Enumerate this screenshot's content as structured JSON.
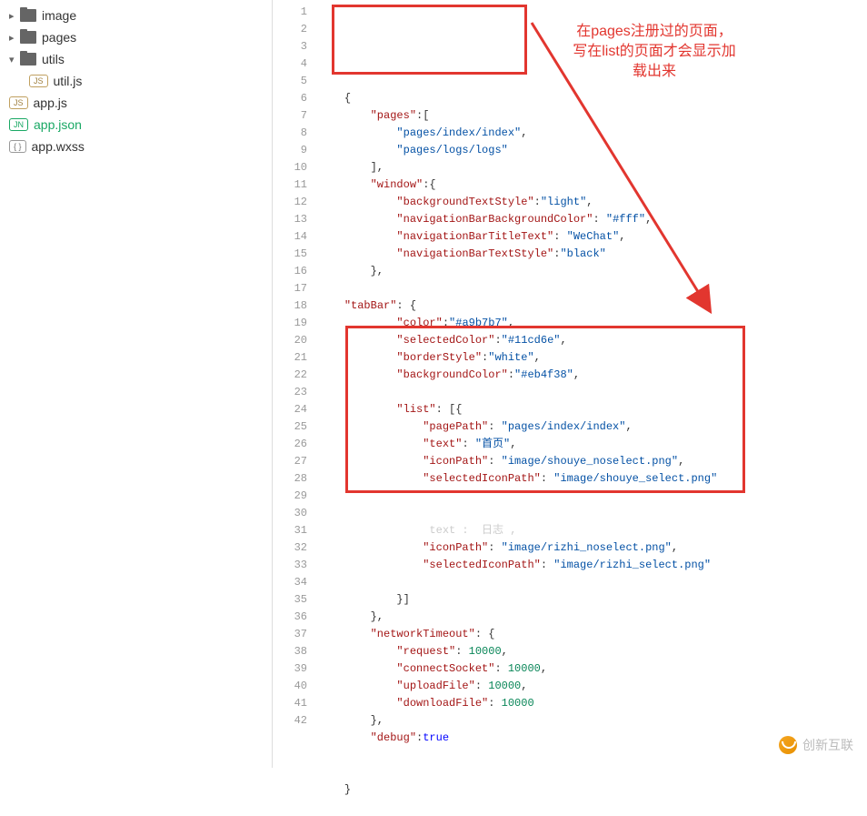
{
  "sidebar": {
    "items": [
      {
        "type": "folder",
        "arrow": "▸",
        "label": "image"
      },
      {
        "type": "folder",
        "arrow": "▸",
        "label": "pages"
      },
      {
        "type": "folder",
        "arrow": "▾",
        "label": "utils"
      },
      {
        "type": "file",
        "nested": true,
        "badge": "JS",
        "badgeClass": "badge-js",
        "label": "util.js"
      },
      {
        "type": "file",
        "badge": "JS",
        "badgeClass": "badge-js",
        "label": "app.js"
      },
      {
        "type": "file",
        "badge": "JN",
        "badgeClass": "badge-jn",
        "label": "app.json",
        "active": true
      },
      {
        "type": "file",
        "badge": "{ }",
        "badgeClass": "",
        "label": "app.wxss"
      }
    ]
  },
  "lines": {
    "count": 42,
    "content": [
      {
        "indent": 1,
        "tokens": [
          {
            "t": "{",
            "c": "punct"
          }
        ]
      },
      {
        "indent": 2,
        "tokens": [
          {
            "t": "\"pages\"",
            "c": "key"
          },
          {
            "t": ":[",
            "c": "punct"
          }
        ]
      },
      {
        "indent": 3,
        "tokens": [
          {
            "t": "\"pages/index/index\"",
            "c": "string"
          },
          {
            "t": ",",
            "c": "punct"
          }
        ]
      },
      {
        "indent": 3,
        "tokens": [
          {
            "t": "\"pages/logs/logs\"",
            "c": "string"
          }
        ]
      },
      {
        "indent": 2,
        "tokens": [
          {
            "t": "],",
            "c": "punct"
          }
        ]
      },
      {
        "indent": 2,
        "tokens": [
          {
            "t": "\"window\"",
            "c": "key"
          },
          {
            "t": ":{",
            "c": "punct"
          }
        ]
      },
      {
        "indent": 3,
        "tokens": [
          {
            "t": "\"backgroundTextStyle\"",
            "c": "key"
          },
          {
            "t": ":",
            "c": "punct"
          },
          {
            "t": "\"light\"",
            "c": "string"
          },
          {
            "t": ",",
            "c": "punct"
          }
        ]
      },
      {
        "indent": 3,
        "tokens": [
          {
            "t": "\"navigationBarBackgroundColor\"",
            "c": "key"
          },
          {
            "t": ": ",
            "c": "punct"
          },
          {
            "t": "\"#fff\"",
            "c": "string"
          },
          {
            "t": ",",
            "c": "punct"
          }
        ]
      },
      {
        "indent": 3,
        "tokens": [
          {
            "t": "\"navigationBarTitleText\"",
            "c": "key"
          },
          {
            "t": ": ",
            "c": "punct"
          },
          {
            "t": "\"WeChat\"",
            "c": "string"
          },
          {
            "t": ",",
            "c": "punct"
          }
        ]
      },
      {
        "indent": 3,
        "tokens": [
          {
            "t": "\"navigationBarTextStyle\"",
            "c": "key"
          },
          {
            "t": ":",
            "c": "punct"
          },
          {
            "t": "\"black\"",
            "c": "string"
          }
        ]
      },
      {
        "indent": 2,
        "tokens": [
          {
            "t": "},",
            "c": "punct"
          }
        ]
      },
      {
        "indent": 0,
        "tokens": []
      },
      {
        "indent": 1,
        "tokens": [
          {
            "t": "\"tabBar\"",
            "c": "key"
          },
          {
            "t": ": {",
            "c": "punct"
          }
        ]
      },
      {
        "indent": 3,
        "tokens": [
          {
            "t": "\"color\"",
            "c": "key"
          },
          {
            "t": ":",
            "c": "punct"
          },
          {
            "t": "\"#a9b7b7\"",
            "c": "string"
          },
          {
            "t": ",",
            "c": "punct"
          }
        ]
      },
      {
        "indent": 3,
        "tokens": [
          {
            "t": "\"selectedColor\"",
            "c": "key"
          },
          {
            "t": ":",
            "c": "punct"
          },
          {
            "t": "\"#11cd6e\"",
            "c": "string"
          },
          {
            "t": ",",
            "c": "punct"
          }
        ]
      },
      {
        "indent": 3,
        "tokens": [
          {
            "t": "\"borderStyle\"",
            "c": "key"
          },
          {
            "t": ":",
            "c": "punct"
          },
          {
            "t": "\"white\"",
            "c": "string"
          },
          {
            "t": ",",
            "c": "punct"
          }
        ]
      },
      {
        "indent": 3,
        "tokens": [
          {
            "t": "\"backgroundColor\"",
            "c": "key"
          },
          {
            "t": ":",
            "c": "punct"
          },
          {
            "t": "\"#eb4f38\"",
            "c": "string"
          },
          {
            "t": ",",
            "c": "punct"
          }
        ]
      },
      {
        "indent": 0,
        "tokens": []
      },
      {
        "indent": 3,
        "tokens": [
          {
            "t": "\"list\"",
            "c": "key"
          },
          {
            "t": ": [{",
            "c": "punct"
          }
        ]
      },
      {
        "indent": 4,
        "tokens": [
          {
            "t": "\"pagePath\"",
            "c": "key"
          },
          {
            "t": ": ",
            "c": "punct"
          },
          {
            "t": "\"pages/index/index\"",
            "c": "string"
          },
          {
            "t": ",",
            "c": "punct"
          }
        ]
      },
      {
        "indent": 4,
        "tokens": [
          {
            "t": "\"text\"",
            "c": "key"
          },
          {
            "t": ": ",
            "c": "punct"
          },
          {
            "t": "\"首页\"",
            "c": "string"
          },
          {
            "t": ",",
            "c": "punct"
          }
        ]
      },
      {
        "indent": 4,
        "tokens": [
          {
            "t": "\"iconPath\"",
            "c": "key"
          },
          {
            "t": ": ",
            "c": "punct"
          },
          {
            "t": "\"image/shouye_noselect.png\"",
            "c": "string"
          },
          {
            "t": ",",
            "c": "punct"
          }
        ]
      },
      {
        "indent": 4,
        "tokens": [
          {
            "t": "\"selectedIconPath\"",
            "c": "key"
          },
          {
            "t": ": ",
            "c": "punct"
          },
          {
            "t": "\"image/shouye_select.png\"",
            "c": "string"
          }
        ]
      },
      {
        "indent": 0,
        "tokens": []
      },
      {
        "indent": 0,
        "tokens": []
      },
      {
        "indent": 4,
        "tokens": [
          {
            "t": " text :  日志 ,",
            "c": "punct"
          }
        ],
        "dim": true
      },
      {
        "indent": 4,
        "tokens": [
          {
            "t": "\"iconPath\"",
            "c": "key"
          },
          {
            "t": ": ",
            "c": "punct"
          },
          {
            "t": "\"image/rizhi_noselect.png\"",
            "c": "string"
          },
          {
            "t": ",",
            "c": "punct"
          }
        ]
      },
      {
        "indent": 4,
        "tokens": [
          {
            "t": "\"selectedIconPath\"",
            "c": "key"
          },
          {
            "t": ": ",
            "c": "punct"
          },
          {
            "t": "\"image/rizhi_select.png\"",
            "c": "string"
          }
        ]
      },
      {
        "indent": 0,
        "tokens": []
      },
      {
        "indent": 3,
        "tokens": [
          {
            "t": "}]",
            "c": "punct"
          }
        ]
      },
      {
        "indent": 2,
        "tokens": [
          {
            "t": "},",
            "c": "punct"
          }
        ]
      },
      {
        "indent": 2,
        "tokens": [
          {
            "t": "\"networkTimeout\"",
            "c": "key"
          },
          {
            "t": ": {",
            "c": "punct"
          }
        ]
      },
      {
        "indent": 3,
        "tokens": [
          {
            "t": "\"request\"",
            "c": "key"
          },
          {
            "t": ": ",
            "c": "punct"
          },
          {
            "t": "10000",
            "c": "number"
          },
          {
            "t": ",",
            "c": "punct"
          }
        ]
      },
      {
        "indent": 3,
        "tokens": [
          {
            "t": "\"connectSocket\"",
            "c": "key"
          },
          {
            "t": ": ",
            "c": "punct"
          },
          {
            "t": "10000",
            "c": "number"
          },
          {
            "t": ",",
            "c": "punct"
          }
        ]
      },
      {
        "indent": 3,
        "tokens": [
          {
            "t": "\"uploadFile\"",
            "c": "key"
          },
          {
            "t": ": ",
            "c": "punct"
          },
          {
            "t": "10000",
            "c": "number"
          },
          {
            "t": ",",
            "c": "punct"
          }
        ]
      },
      {
        "indent": 3,
        "tokens": [
          {
            "t": "\"downloadFile\"",
            "c": "key"
          },
          {
            "t": ": ",
            "c": "punct"
          },
          {
            "t": "10000",
            "c": "number"
          }
        ]
      },
      {
        "indent": 2,
        "tokens": [
          {
            "t": "},",
            "c": "punct"
          }
        ]
      },
      {
        "indent": 2,
        "tokens": [
          {
            "t": "\"debug\"",
            "c": "key"
          },
          {
            "t": ":",
            "c": "punct"
          },
          {
            "t": "true",
            "c": "boolean"
          }
        ]
      },
      {
        "indent": 0,
        "tokens": []
      },
      {
        "indent": 0,
        "tokens": []
      },
      {
        "indent": 1,
        "tokens": [
          {
            "t": "}",
            "c": "punct"
          }
        ]
      },
      {
        "indent": 0,
        "tokens": []
      }
    ]
  },
  "annotation": {
    "line1": "在pages注册过的页面，",
    "line2": "写在list的页面才会显示加",
    "line3": "载出来"
  },
  "watermark": "创新互联"
}
